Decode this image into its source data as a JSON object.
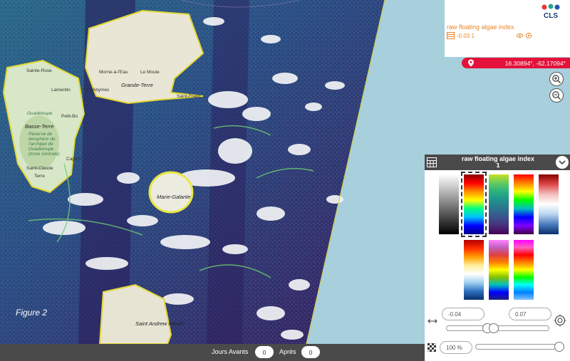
{
  "map": {
    "figure_label": "Figure 2",
    "places": [
      {
        "name": "Sainte-Rose",
        "type": "town"
      },
      {
        "name": "Morne-à-l'Eau",
        "type": "town"
      },
      {
        "name": "Le Moule",
        "type": "town"
      },
      {
        "name": "Grande-Terre",
        "type": "region"
      },
      {
        "name": "Lamentin",
        "type": "town"
      },
      {
        "name": "Les Abymes",
        "type": "town"
      },
      {
        "name": "Saint-Franç",
        "type": "town"
      },
      {
        "name": "Guadeloupe",
        "type": "park"
      },
      {
        "name": "Petit-Bo",
        "type": "town"
      },
      {
        "name": "Basse-Terre",
        "type": "region"
      },
      {
        "name": "Réserve de biosphère de l'archipel de Guadeloupe (zone centrale)",
        "type": "park"
      },
      {
        "name": "Capest",
        "type": "town"
      },
      {
        "name": "Saint-Claude",
        "type": "town"
      },
      {
        "name": "Terre",
        "type": "town"
      },
      {
        "name": "Marie-Galante",
        "type": "region"
      },
      {
        "name": "Saint Andrew Parish",
        "type": "region"
      }
    ]
  },
  "legend": {
    "title": "raw floating algae index",
    "range_text": "-0.03 1",
    "logo_text": "CLS"
  },
  "coords": {
    "text": "16.30894°, -62.17094°"
  },
  "zoom": {
    "in_icon": "zoom-in-icon",
    "out_icon": "zoom-out-icon"
  },
  "palette_panel": {
    "title": "raw floating algae index",
    "subtitle": "1",
    "selected_index": 1,
    "palettes": [
      {
        "name": "greyscale",
        "colors": [
          "#ffffff",
          "#000000"
        ]
      },
      {
        "name": "jet",
        "colors": [
          "#8b0000",
          "#ff0000",
          "#ff8c00",
          "#ffff00",
          "#00ff80",
          "#00bfff",
          "#0000ff",
          "#00008b"
        ]
      },
      {
        "name": "viridis",
        "colors": [
          "#c8e020",
          "#6ece58",
          "#35b779",
          "#1f9e89",
          "#26828e",
          "#31688e",
          "#3e4a89",
          "#482878",
          "#440154"
        ]
      },
      {
        "name": "spectral",
        "colors": [
          "#ff0000",
          "#ff8000",
          "#ffff00",
          "#00ff00",
          "#00c0c0",
          "#0000ff",
          "#8000ff",
          "#400040"
        ]
      },
      {
        "name": "redblue",
        "colors": [
          "#8b0000",
          "#e04848",
          "#f4c0c0",
          "#ffffff",
          "#b8d4f0",
          "#4a7cc0",
          "#08306b"
        ]
      },
      {
        "name": "hot-cold",
        "colors": [
          "#b40000",
          "#ff3000",
          "#ffa000",
          "#fff0a0",
          "#ffffff",
          "#a0d0f0",
          "#3070c0",
          "#08306b"
        ]
      },
      {
        "name": "multicolor",
        "colors": [
          "#ff80ff",
          "#c060c0",
          "#e04040",
          "#ff8000",
          "#ffff00",
          "#80c000",
          "#00c0c0",
          "#0000ff",
          "#202080"
        ]
      },
      {
        "name": "banded",
        "colors": [
          "#ff00ff",
          "#ff60c0",
          "#ff0000",
          "#ff8000",
          "#ffff00",
          "#00ff00",
          "#00ffff",
          "#0080ff",
          "#80c0ff"
        ]
      }
    ],
    "min_value": "-0.04",
    "max_value": "0.07",
    "range_slider": {
      "min_fraction": 0.4,
      "max_fraction": 0.46
    },
    "opacity": "100 %",
    "opacity_fraction": 1.0
  },
  "bottom_bar": {
    "before_label": "Jours Avants",
    "before_value": "0",
    "after_label": "Après",
    "after_value": "0"
  },
  "colors": {
    "accent_red": "#e4123a",
    "legend_orange": "#e8862a",
    "panel_dark": "#4a4a4a",
    "sea": "#a7cfdc",
    "ocean_dark": "#3b1a5a",
    "algae_green": "#3fb080",
    "algae_yellow": "#e8e030"
  }
}
